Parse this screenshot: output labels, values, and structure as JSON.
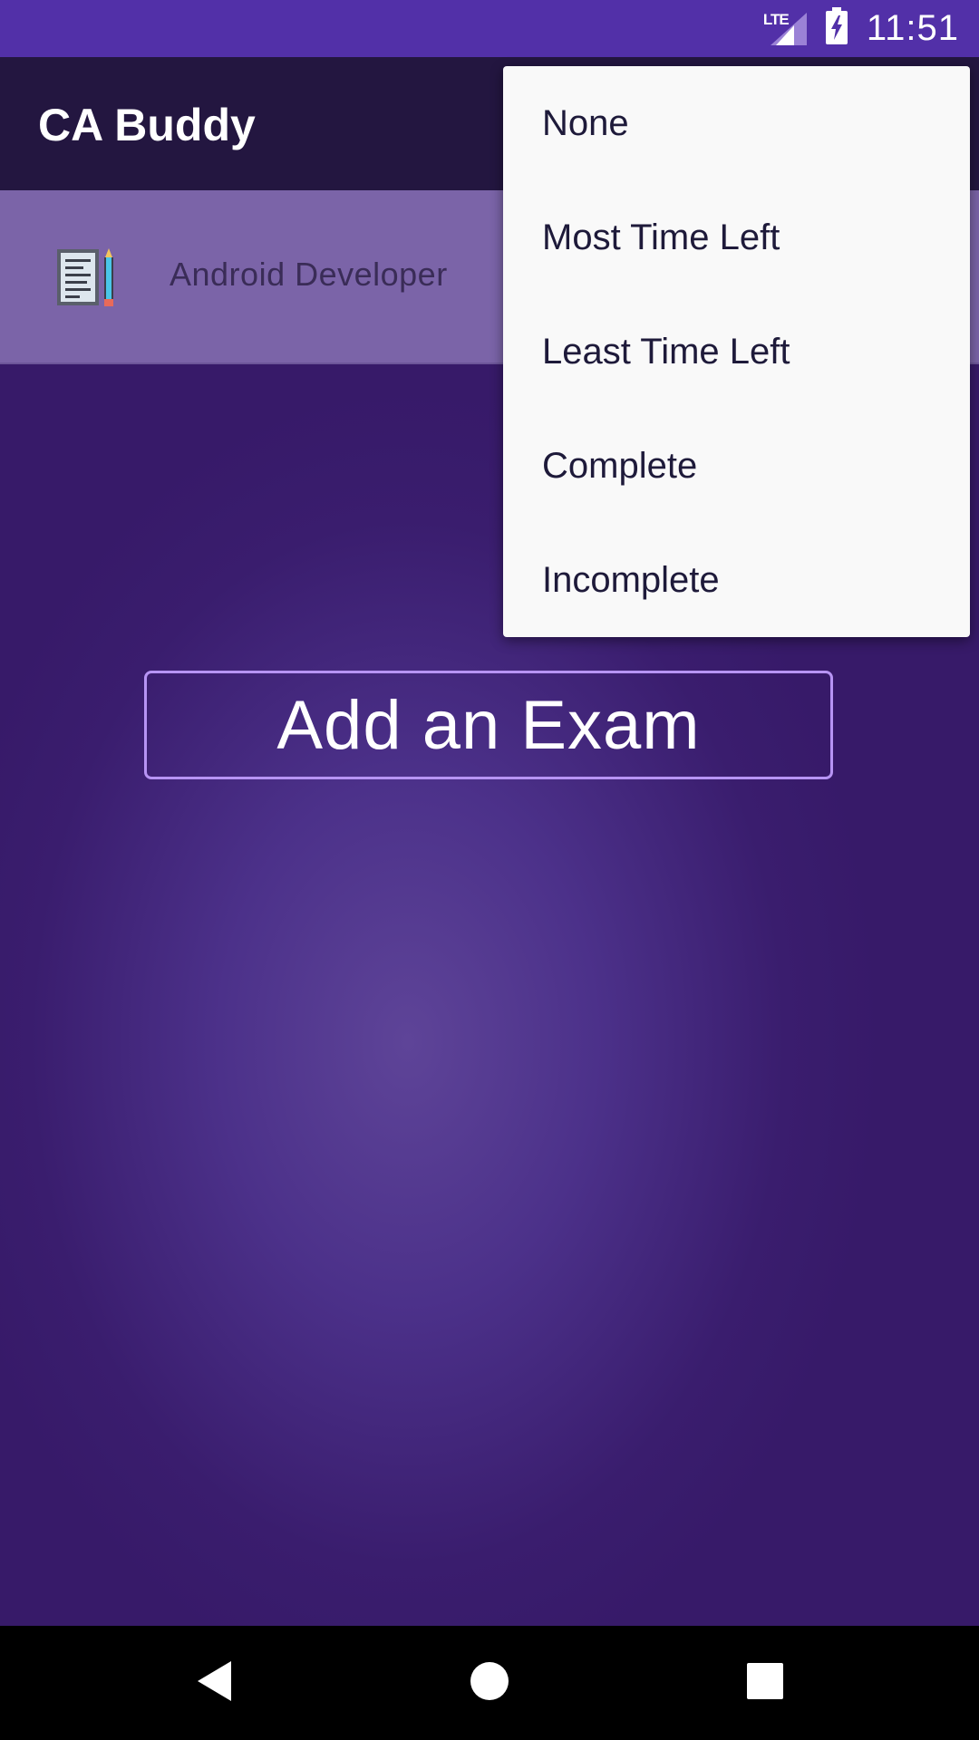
{
  "status_bar": {
    "network_label": "LTE",
    "time": "11:51",
    "icons": [
      "signal-icon",
      "battery-charging-icon"
    ]
  },
  "app_bar": {
    "title": "CA Buddy"
  },
  "profile_card": {
    "icon": "notepad-pencil-icon",
    "label": "Android Developer"
  },
  "main": {
    "add_exam_label": "Add an Exam"
  },
  "sort_menu": {
    "items": [
      {
        "label": "None"
      },
      {
        "label": "Most Time Left"
      },
      {
        "label": "Least Time Left"
      },
      {
        "label": "Complete"
      },
      {
        "label": "Incomplete"
      }
    ]
  },
  "nav_bar": {
    "icons": [
      "back-icon",
      "home-icon",
      "recents-icon"
    ]
  },
  "colors": {
    "status_bar": "#5230a8",
    "app_bar": "#231640",
    "background": "#3a1d6e",
    "card": "#7b64a8",
    "button_border": "#b794f4",
    "menu_background": "#f9f9f9"
  }
}
